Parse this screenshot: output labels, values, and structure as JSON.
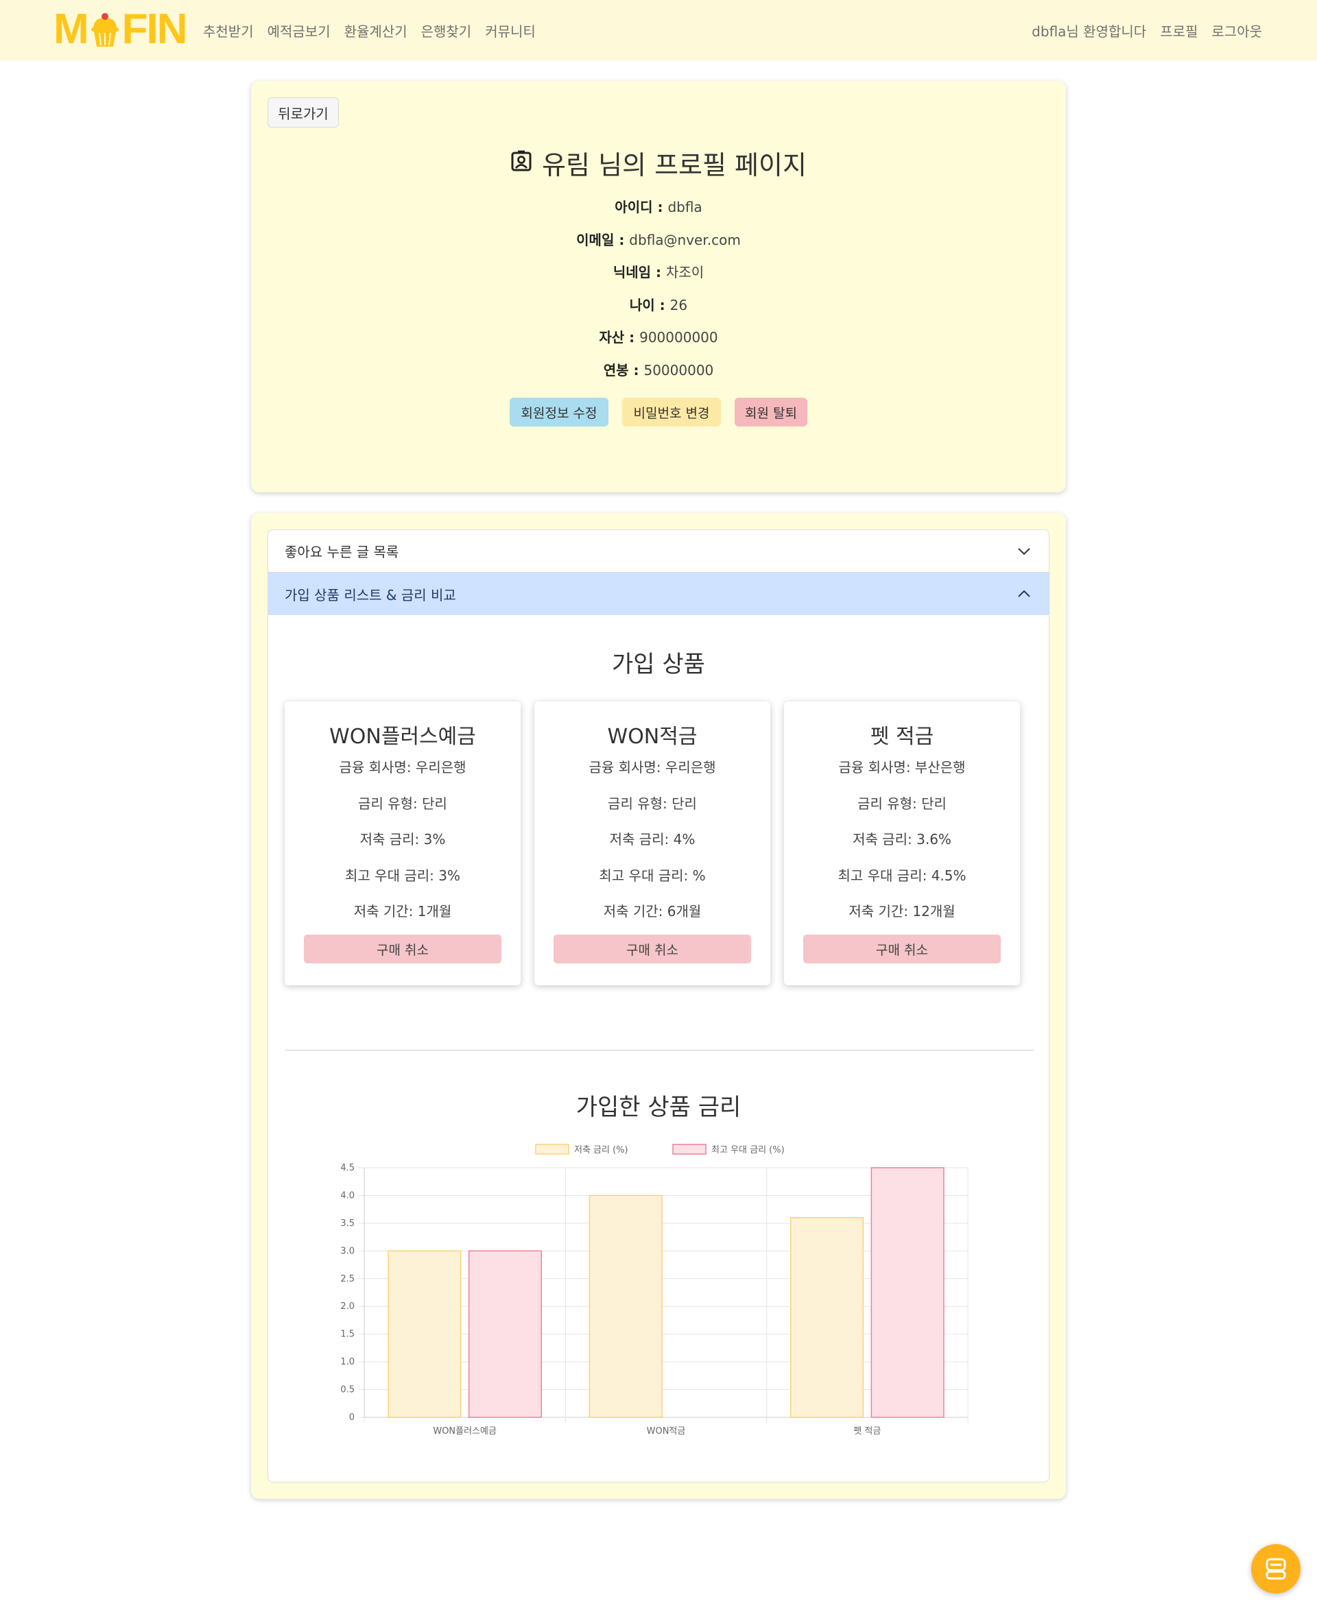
{
  "navbar": {
    "logo_text_left": "M",
    "logo_text_right": "FIN",
    "links": [
      "추천받기",
      "예적금보기",
      "환율계산기",
      "은행찾기",
      "커뮤니티"
    ],
    "welcome": "dbfla님 환영합니다",
    "profile": "프로필",
    "logout": "로그아웃"
  },
  "profile": {
    "back_label": "뒤로가기",
    "title": "유림 님의 프로필 페이지",
    "fields": [
      {
        "label": "아이디",
        "value": "dbfla"
      },
      {
        "label": "이메일",
        "value": "dbfla@nver.com"
      },
      {
        "label": "닉네임",
        "value": "차조이"
      },
      {
        "label": "나이",
        "value": "26"
      },
      {
        "label": "자산",
        "value": "900000000"
      },
      {
        "label": "연봉",
        "value": "50000000"
      }
    ],
    "separator": " : ",
    "buttons": {
      "edit": "회원정보 수정",
      "password": "비밀번호 변경",
      "withdraw": "회원 탈퇴"
    }
  },
  "accordion": {
    "liked_posts": "좋아요 누른 글 목록",
    "products_compare": "가입 상품 리스트 & 금리 비교"
  },
  "products_section": {
    "title": "가입 상품",
    "cancel_label": "구매 취소",
    "items": [
      {
        "name": "WON플러스예금",
        "company": "금융 회사명: 우리은행",
        "rate_type": "금리 유형: 단리",
        "rate": "저축 금리: 3%",
        "max_rate": "최고 우대 금리: 3%",
        "term": "저축 기간: 1개월"
      },
      {
        "name": "WON적금",
        "company": "금융 회사명: 우리은행",
        "rate_type": "금리 유형: 단리",
        "rate": "저축 금리: 4%",
        "max_rate": "최고 우대 금리: %",
        "term": "저축 기간: 6개월"
      },
      {
        "name": "펫 적금",
        "company": "금융 회사명: 부산은행",
        "rate_type": "금리 유형: 단리",
        "rate": "저축 금리: 3.6%",
        "max_rate": "최고 우대 금리: 4.5%",
        "term": "저축 기간: 12개월"
      }
    ]
  },
  "rates_section": {
    "title": "가입한 상품 금리"
  },
  "chart_data": {
    "type": "bar",
    "categories": [
      "WON플러스예금",
      "WON적금",
      "펫 적금"
    ],
    "series": [
      {
        "name": "저축 금리 (%)",
        "values": [
          3,
          4,
          3.6
        ],
        "fill": "#fdf2d6",
        "stroke": "#f9d27a"
      },
      {
        "name": "최고 우대 금리 (%)",
        "values": [
          3,
          null,
          4.5
        ],
        "fill": "#fde0e6",
        "stroke": "#ef7f98"
      }
    ],
    "ylim": [
      0,
      4.5
    ],
    "yticks": [
      "0",
      "0.5",
      "1.0",
      "1.5",
      "2.0",
      "2.5",
      "3.0",
      "3.5",
      "4.0",
      "4.5"
    ],
    "grid": true,
    "legend_position": "top"
  },
  "colors": {
    "navbar_bg": "#fef9d9",
    "card_bg": "#fefcd9",
    "logo": "#ffc61a",
    "accordion_active": "#cfe2ff",
    "bot_button": "#ffb21c"
  },
  "icons": {
    "profile_title": "person-badge-icon",
    "chevron_down": "chevron-down-icon",
    "chevron_up": "chevron-up-icon",
    "bot": "robot-icon"
  }
}
